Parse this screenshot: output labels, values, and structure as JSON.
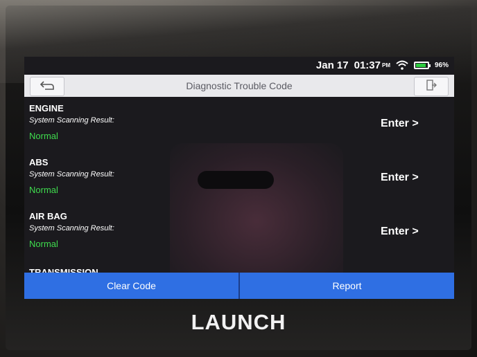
{
  "status_bar": {
    "date": "Jan 17",
    "time": "01:37",
    "ampm": "PM",
    "battery": "96%",
    "icons": [
      "wifi-icon",
      "battery-icon"
    ]
  },
  "title_bar": {
    "title": "Diagnostic Trouble Code",
    "back_icon": "back-arrow-icon",
    "exit_icon": "exit-icon"
  },
  "systems": [
    {
      "name": "ENGINE",
      "label": "System Scanning Result:",
      "status": "Normal",
      "action": "Enter >"
    },
    {
      "name": "ABS",
      "label": "System Scanning Result:",
      "status": "Normal",
      "action": "Enter >"
    },
    {
      "name": "AIR BAG",
      "label": "System Scanning Result:",
      "status": "Normal",
      "action": "Enter >"
    }
  ],
  "partial_item": "TRANSMISSION",
  "bottom_bar": {
    "clear_label": "Clear Code",
    "report_label": "Report"
  },
  "brand": "LAUNCH",
  "colors": {
    "accent_button": "#2f6fe3",
    "status_normal": "#3fdc4e",
    "title_bar_bg": "#e9e9ec"
  }
}
